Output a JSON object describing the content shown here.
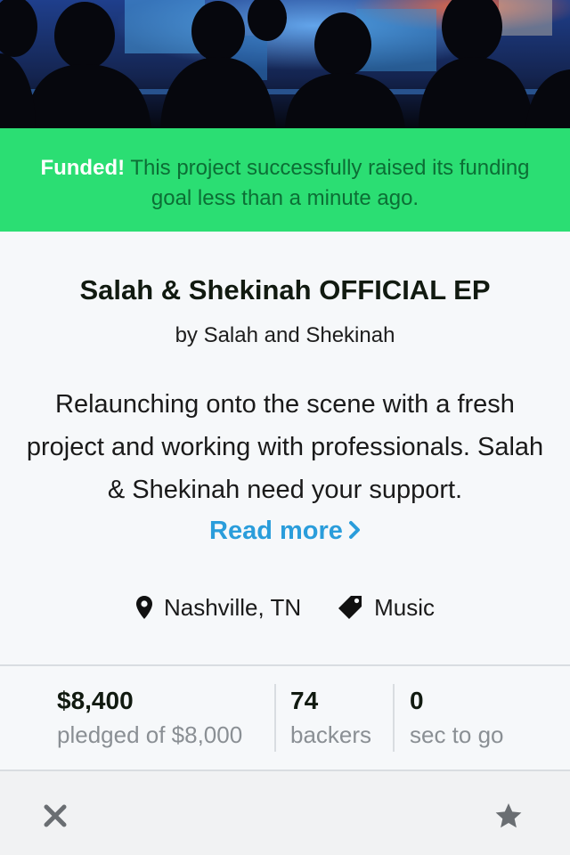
{
  "banner": {
    "funded_label": "Funded!",
    "message": "This project successfully raised its funding goal less than a minute ago."
  },
  "project": {
    "title": "Salah & Shekinah OFFICIAL EP",
    "byline": "by Salah and Shekinah",
    "blurb": "Relaunching onto the scene with a fresh project and working with professionals. Salah & Shekinah need your support.",
    "read_more_label": "Read more",
    "location": "Nashville, TN",
    "category": "Music"
  },
  "stats": {
    "pledged_value": "$8,400",
    "pledged_label": "pledged of $8,000",
    "backers_value": "74",
    "backers_label": "backers",
    "time_value": "0",
    "time_label": "sec to go"
  },
  "toolbar": {
    "close_icon": "close-icon",
    "star_icon": "star-icon"
  },
  "colors": {
    "funded_green": "#2bde73",
    "link_blue": "#2a9ddb",
    "muted_gray": "#8a8f94"
  }
}
